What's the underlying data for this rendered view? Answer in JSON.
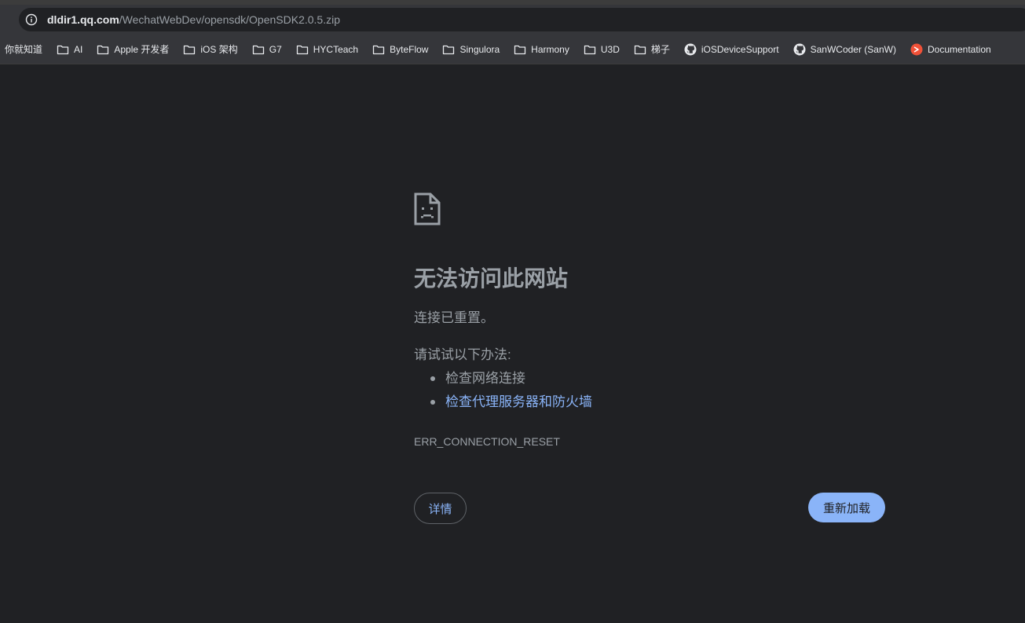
{
  "addressbar": {
    "host": "dldir1.qq.com",
    "path": "/WechatWebDev/opensdk/OpenSDK2.0.5.zip",
    "info_icon": "info-icon"
  },
  "bookmarks": [
    {
      "label": "你就知道",
      "icon": "none"
    },
    {
      "label": "AI",
      "icon": "folder-icon"
    },
    {
      "label": "Apple 开发者",
      "icon": "folder-icon"
    },
    {
      "label": "iOS 架构",
      "icon": "folder-icon"
    },
    {
      "label": "G7",
      "icon": "folder-icon"
    },
    {
      "label": "HYCTeach",
      "icon": "folder-icon"
    },
    {
      "label": "ByteFlow",
      "icon": "folder-icon"
    },
    {
      "label": "Singulora",
      "icon": "folder-icon"
    },
    {
      "label": "Harmony",
      "icon": "folder-icon"
    },
    {
      "label": "U3D",
      "icon": "folder-icon"
    },
    {
      "label": "梯子",
      "icon": "folder-icon"
    },
    {
      "label": "iOSDeviceSupport",
      "icon": "github-icon"
    },
    {
      "label": "SanWCoder (SanW)",
      "icon": "github-icon"
    },
    {
      "label": "Documentation",
      "icon": "swift-icon"
    }
  ],
  "error": {
    "icon": "sad-page-icon",
    "title": "无法访问此网站",
    "subtitle": "连接已重置。",
    "try_label": "请试试以下办法:",
    "suggestions": [
      "检查网络连接",
      "检查代理服务器和防火墙"
    ],
    "code": "ERR_CONNECTION_RESET",
    "details_label": "详情",
    "reload_label": "重新加载"
  },
  "colors": {
    "background": "#202124",
    "link": "#8ab4f8",
    "muted_text": "#9aa0a6"
  }
}
